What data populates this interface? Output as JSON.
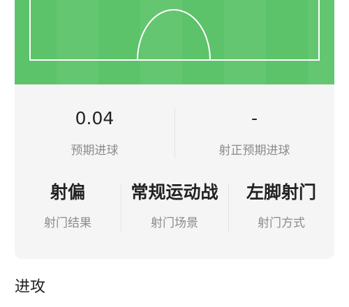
{
  "colors": {
    "pitch": "#5cc36a",
    "card_bg": "#f5f5f6",
    "label": "#8b8b8b"
  },
  "pitch": {
    "type": "football-pitch-half",
    "lines": "white"
  },
  "stats_top": [
    {
      "value": "0.04",
      "label": "预期进球"
    },
    {
      "value": "-",
      "label": "射正预期进球"
    }
  ],
  "stats_bottom": [
    {
      "value": "射偏",
      "label": "射门结果"
    },
    {
      "value": "常规运动战",
      "label": "射门场景"
    },
    {
      "value": "左脚射门",
      "label": "射门方式"
    }
  ],
  "section": {
    "title": "进攻"
  }
}
